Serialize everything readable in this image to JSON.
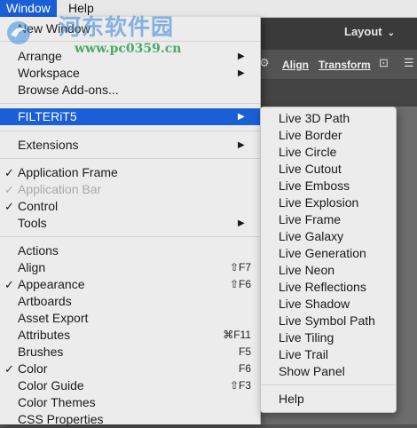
{
  "menubar": {
    "items": [
      {
        "label": "Window",
        "active": true
      },
      {
        "label": "Help",
        "active": false
      }
    ]
  },
  "window_menu": {
    "items": [
      {
        "label": "New Window"
      },
      {
        "label": "Arrange",
        "submenu": true
      },
      {
        "label": "Workspace",
        "submenu": true
      },
      {
        "label": "Browse Add-ons..."
      },
      {
        "label": "FILTERiT5",
        "submenu": true,
        "highlighted": true
      },
      {
        "label": "Extensions",
        "submenu": true
      },
      {
        "label": "Application Frame",
        "checked": true
      },
      {
        "label": "Application Bar",
        "checked": true,
        "disabled": true
      },
      {
        "label": "Control",
        "checked": true
      },
      {
        "label": "Tools",
        "submenu": true
      },
      {
        "label": "Actions"
      },
      {
        "label": "Align",
        "shortcut": "⇧F7"
      },
      {
        "label": "Appearance",
        "checked": true,
        "shortcut": "⇧F6"
      },
      {
        "label": "Artboards"
      },
      {
        "label": "Asset Export"
      },
      {
        "label": "Attributes",
        "shortcut": "⌘F11"
      },
      {
        "label": "Brushes",
        "shortcut": "F5"
      },
      {
        "label": "Color",
        "checked": true,
        "shortcut": "F6"
      },
      {
        "label": "Color Guide",
        "shortcut": "⇧F3"
      },
      {
        "label": "Color Themes"
      },
      {
        "label": "CSS Properties"
      }
    ]
  },
  "filterit_submenu": {
    "items": [
      {
        "label": "Live 3D Path"
      },
      {
        "label": "Live Border"
      },
      {
        "label": "Live Circle"
      },
      {
        "label": "Live Cutout"
      },
      {
        "label": "Live Emboss"
      },
      {
        "label": "Live Explosion"
      },
      {
        "label": "Live Frame"
      },
      {
        "label": "Live Galaxy"
      },
      {
        "label": "Live Generation"
      },
      {
        "label": "Live Neon"
      },
      {
        "label": "Live Reflections"
      },
      {
        "label": "Live Shadow"
      },
      {
        "label": "Live Symbol Path"
      },
      {
        "label": "Live Tiling"
      },
      {
        "label": "Live Trail"
      },
      {
        "label": "Show Panel"
      },
      {
        "label": "Help"
      }
    ]
  },
  "app": {
    "layout_label": "Layout",
    "align_label": "Align",
    "transform_label": "Transform"
  },
  "glyphs": {
    "check": "✓",
    "submenu_arrow": "▶",
    "chevron": "⌄"
  },
  "watermark": {
    "title": "河东软件园",
    "url": "www.pc0359.cn"
  },
  "colors": {
    "highlight": "#1a5fd6",
    "menu_bg": "#ececec",
    "disabled_text": "#a8a8a8"
  }
}
